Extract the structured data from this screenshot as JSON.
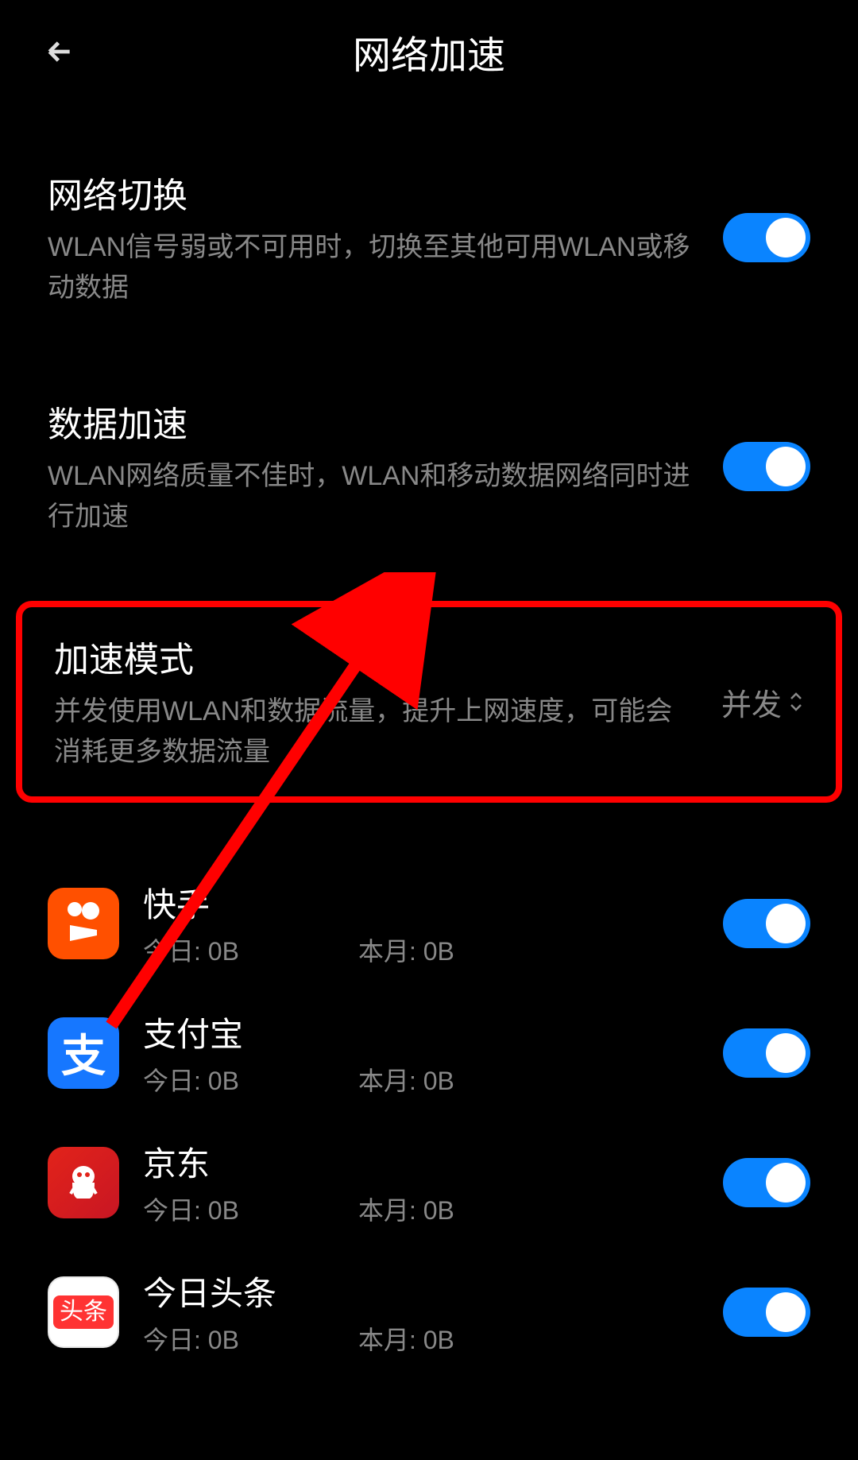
{
  "header": {
    "title": "网络加速"
  },
  "settings": {
    "network_switch": {
      "title": "网络切换",
      "desc": "WLAN信号弱或不可用时，切换至其他可用WLAN或移动数据",
      "enabled": true
    },
    "data_accel": {
      "title": "数据加速",
      "desc": "WLAN网络质量不佳时，WLAN和移动数据网络同时进行加速",
      "enabled": true
    },
    "accel_mode": {
      "title": "加速模式",
      "desc": "并发使用WLAN和数据流量，提升上网速度，可能会消耗更多数据流量",
      "value": "并发"
    }
  },
  "apps": [
    {
      "name": "快手",
      "today": "今日: 0B",
      "month": "本月: 0B",
      "enabled": true,
      "icon": "kuaishou"
    },
    {
      "name": "支付宝",
      "today": "今日: 0B",
      "month": "本月: 0B",
      "enabled": true,
      "icon": "alipay"
    },
    {
      "name": "京东",
      "today": "今日: 0B",
      "month": "本月: 0B",
      "enabled": true,
      "icon": "jd"
    },
    {
      "name": "今日头条",
      "today": "今日: 0B",
      "month": "本月: 0B",
      "enabled": true,
      "icon": "toutiao"
    }
  ],
  "icon_labels": {
    "alipay_char": "支",
    "toutiao_char": "头条"
  }
}
